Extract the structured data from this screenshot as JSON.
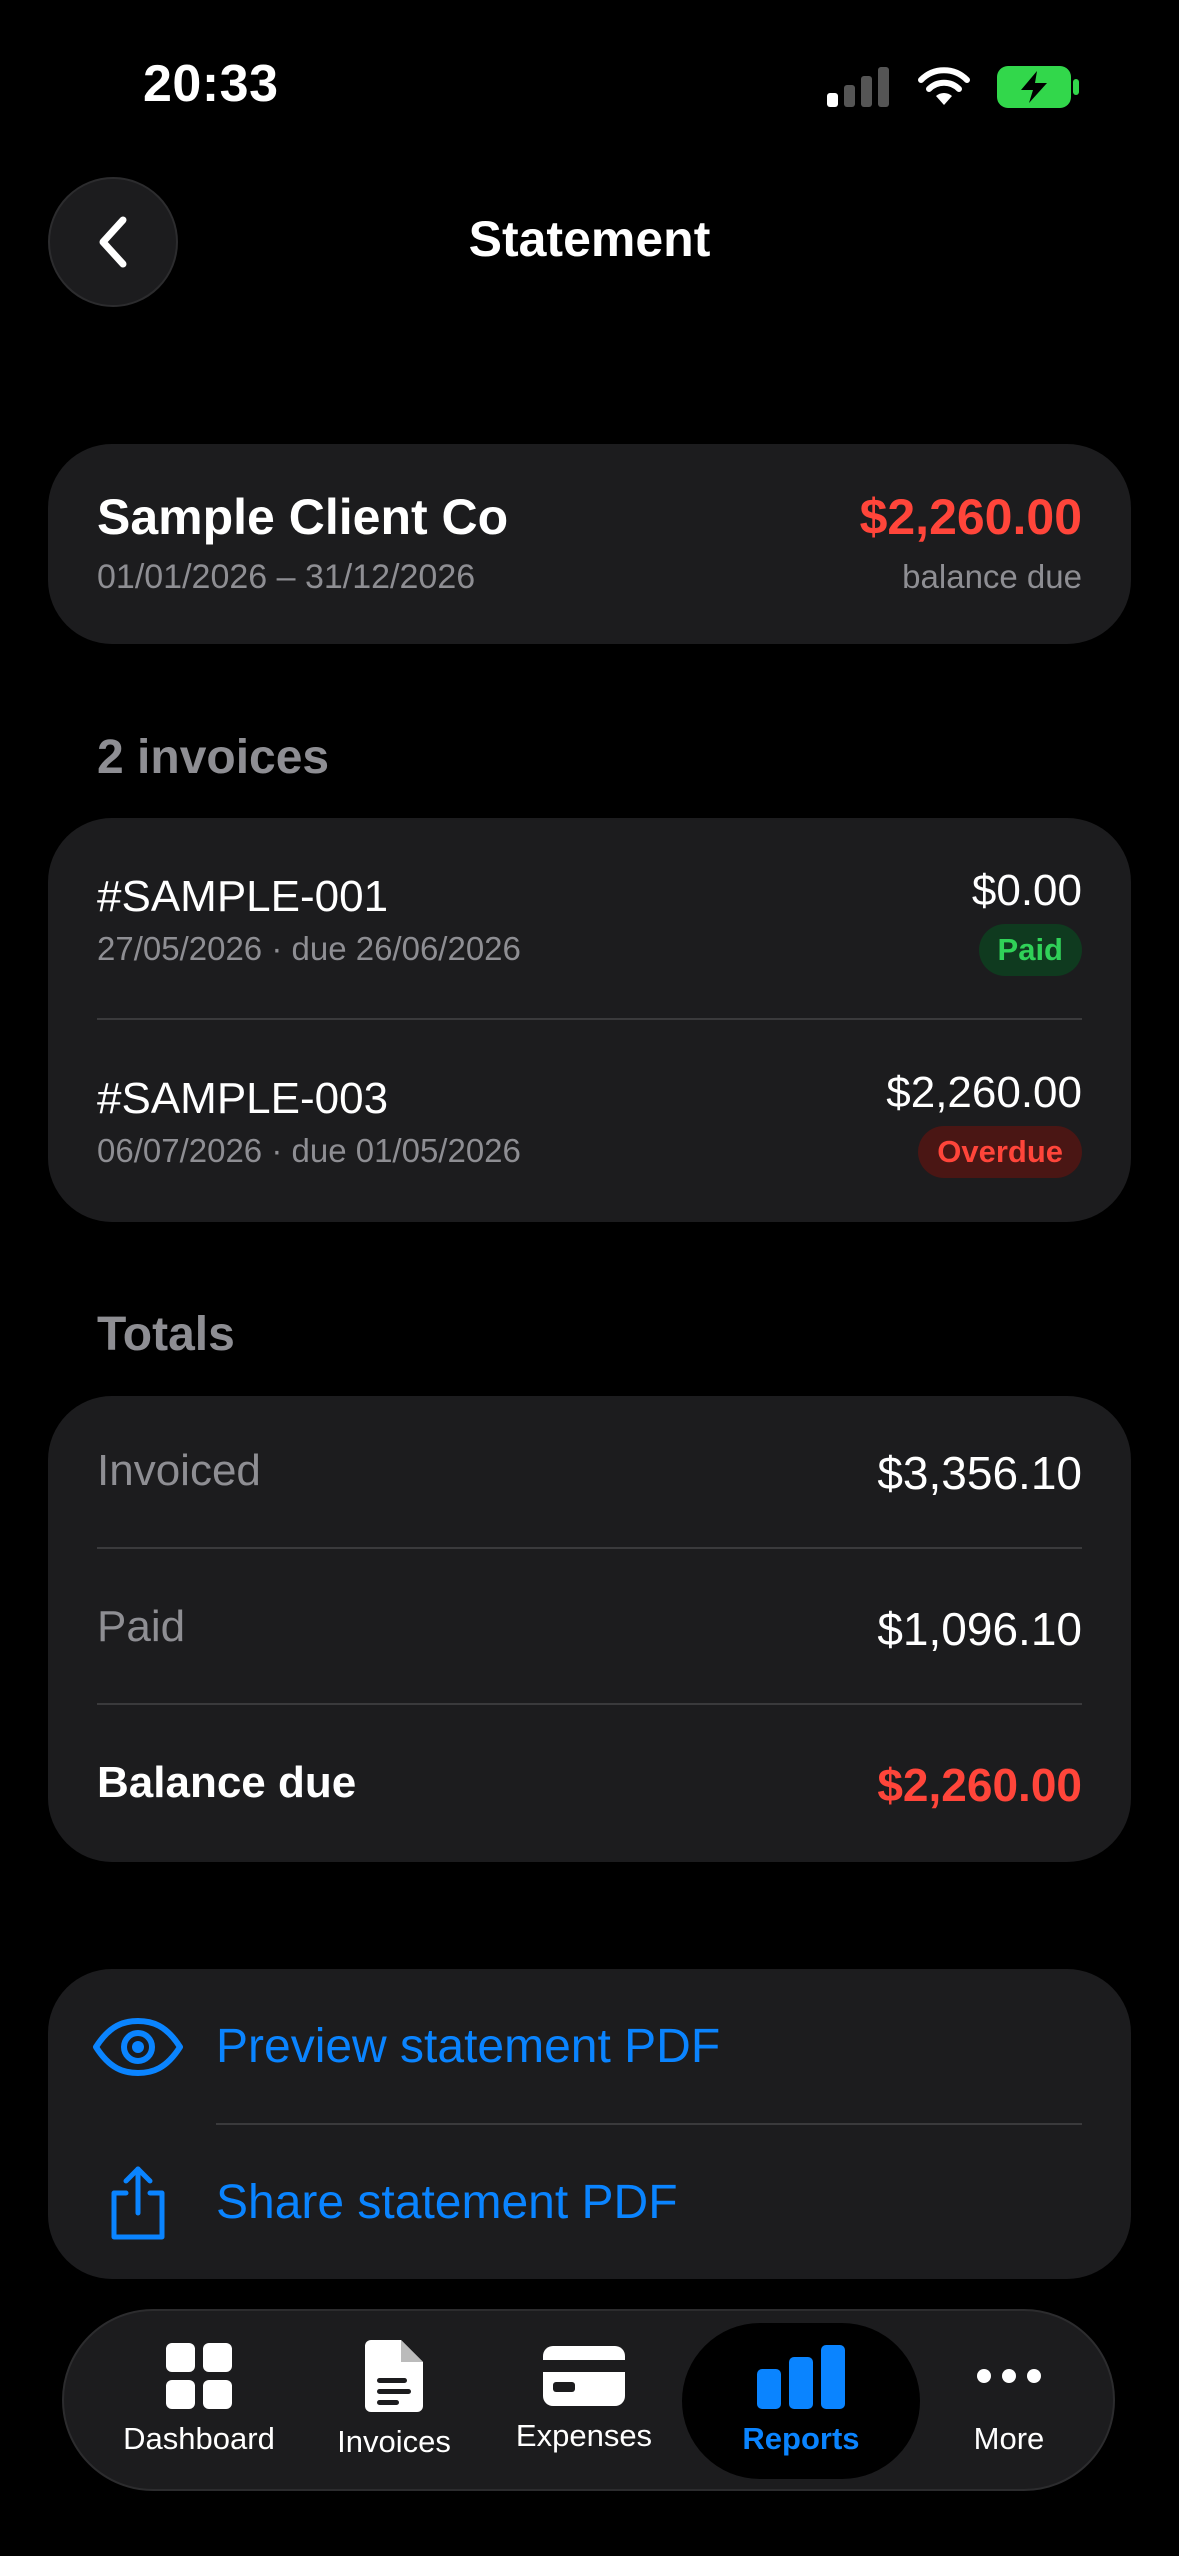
{
  "status_bar": {
    "time": "20:33"
  },
  "header": {
    "title": "Statement"
  },
  "client": {
    "name": "Sample Client Co",
    "period": "01/01/2026 – 31/12/2026",
    "balance": "$2,260.00",
    "balance_label": "balance due"
  },
  "invoices_section": {
    "title": "2 invoices",
    "items": [
      {
        "number": "#SAMPLE-001",
        "dates": "27/05/2026 · due 26/06/2026",
        "amount": "$0.00",
        "status": "Paid"
      },
      {
        "number": "#SAMPLE-003",
        "dates": "06/07/2026 · due 01/05/2026",
        "amount": "$2,260.00",
        "status": "Overdue"
      }
    ]
  },
  "totals": {
    "title": "Totals",
    "rows": [
      {
        "label": "Invoiced",
        "value": "$3,356.10"
      },
      {
        "label": "Paid",
        "value": "$1,096.10"
      },
      {
        "label": "Balance due",
        "value": "$2,260.00"
      }
    ]
  },
  "actions": {
    "preview_label": "Preview statement PDF",
    "share_label": "Share statement PDF"
  },
  "tabbar": {
    "items": [
      {
        "label": "Dashboard",
        "icon": "grid-icon"
      },
      {
        "label": "Invoices",
        "icon": "document-icon"
      },
      {
        "label": "Expenses",
        "icon": "card-icon"
      },
      {
        "label": "Reports",
        "icon": "bar-chart-icon",
        "active": true
      },
      {
        "label": "More",
        "icon": "ellipsis-icon"
      }
    ]
  },
  "colors": {
    "accent": "#0a84ff",
    "negative": "#ff453a",
    "positive": "#30d158",
    "card": "#1c1c1e",
    "secondary_text": "#8e8e93"
  }
}
